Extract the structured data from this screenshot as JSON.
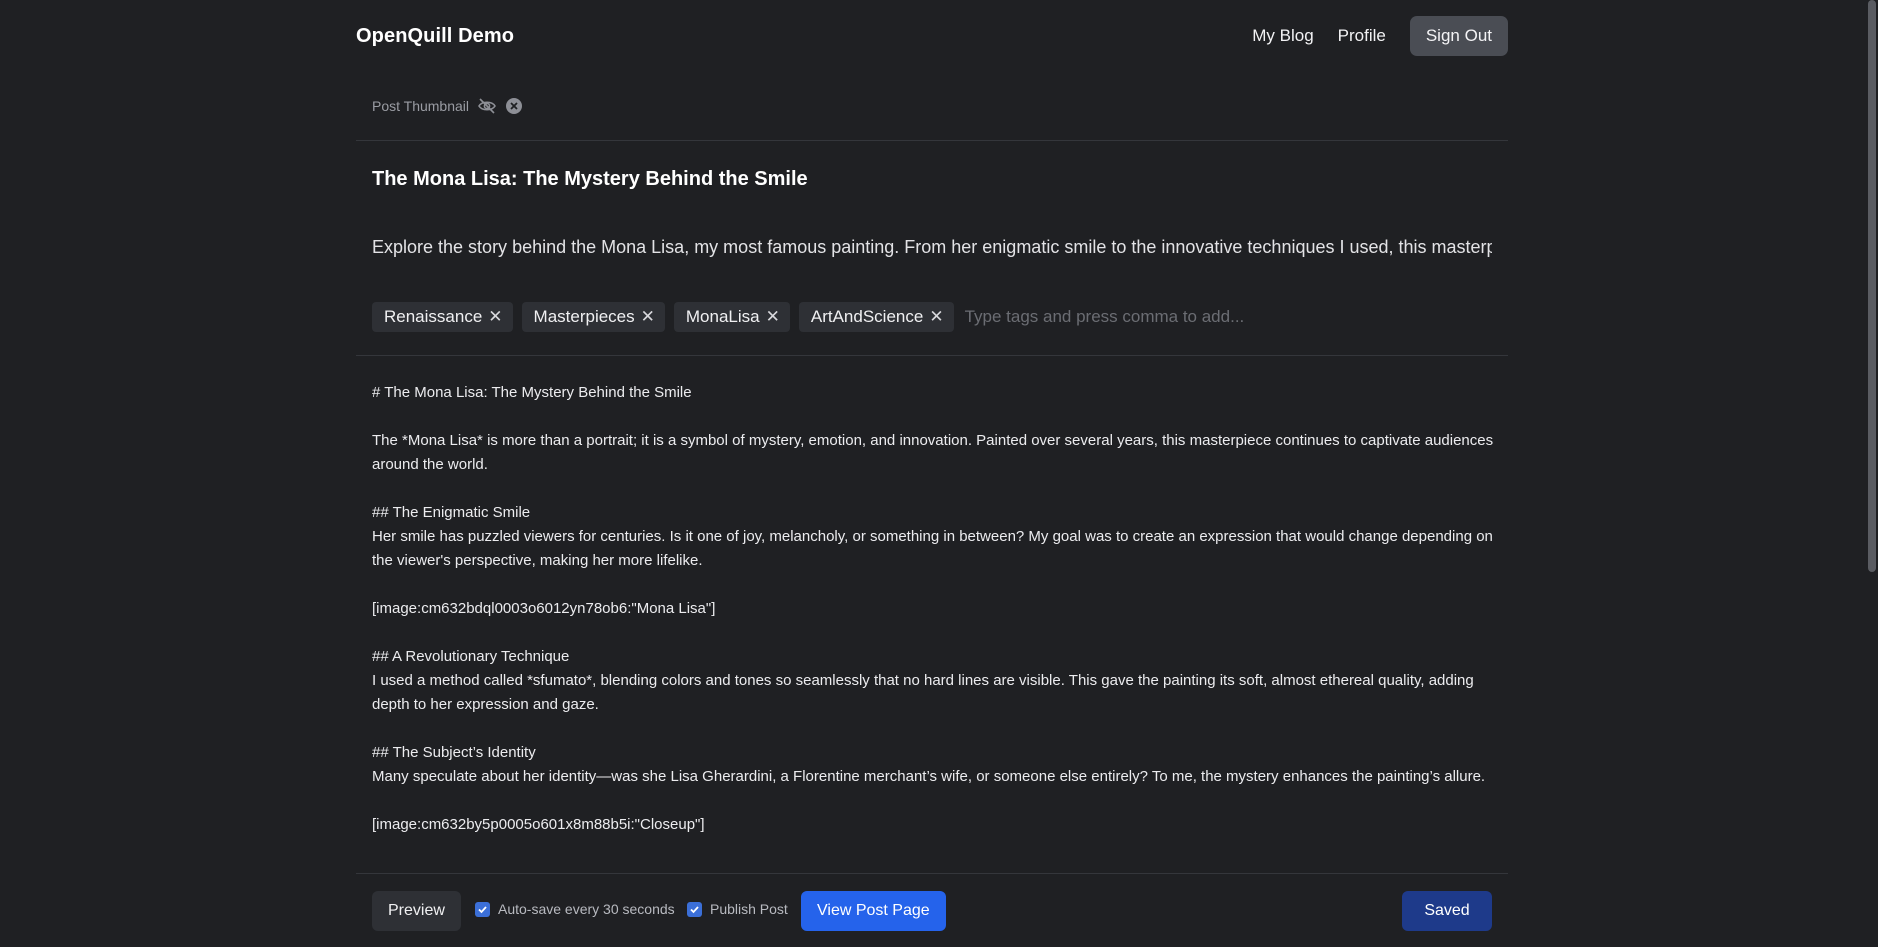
{
  "header": {
    "brand": "OpenQuill Demo",
    "nav": [
      "My Blog",
      "Profile"
    ],
    "sign_out": "Sign Out"
  },
  "thumbnail": {
    "label": "Post Thumbnail",
    "icons": [
      "eye-off-icon",
      "close-circle-icon"
    ]
  },
  "post": {
    "title": "The Mona Lisa: The Mystery Behind the Smile",
    "description": "Explore the story behind the Mona Lisa, my most famous painting. From her enigmatic smile to the innovative techniques I used, this masterp",
    "tags": [
      "Renaissance",
      "Masterpieces",
      "MonaLisa",
      "ArtAndScience"
    ],
    "tag_placeholder": "Type tags and press comma to add..."
  },
  "editor": {
    "lines": [
      "# The Mona Lisa: The Mystery Behind the Smile",
      "",
      "The *Mona Lisa* is more than a portrait; it is a symbol of mystery, emotion, and innovation. Painted over several years, this masterpiece continues to captivate audiences around the world.",
      "",
      "## The Enigmatic Smile",
      "Her smile has puzzled viewers for centuries. Is it one of joy, melancholy, or something in between? My goal was to create an expression that would change depending on the viewer's perspective, making her more lifelike.",
      "",
      "[image:cm632bdql0003o6012yn78ob6:\"Mona Lisa\"]",
      "",
      "## A Revolutionary Technique",
      "I used a method called *sfumato*, blending colors and tones so seamlessly that no hard lines are visible. This gave the painting its soft, almost ethereal quality, adding depth to her expression and gaze.",
      "",
      "## The Subject’s Identity",
      "Many speculate about her identity—was she Lisa Gherardini, a Florentine merchant’s wife, or someone else entirely? To me, the mystery enhances the painting’s allure.",
      "",
      "[image:cm632by5p0005o601x8m88b5i:\"Closeup\"]"
    ]
  },
  "bottom": {
    "preview": "Preview",
    "autosave_label": "Auto-save every 30 seconds",
    "autosave_checked": true,
    "publish_label": "Publish Post",
    "publish_checked": true,
    "view_post": "View Post Page",
    "saved": "Saved"
  },
  "colors": {
    "background": "#1f2023",
    "primary": "#2563eb",
    "saved": "#1e3a8a"
  }
}
